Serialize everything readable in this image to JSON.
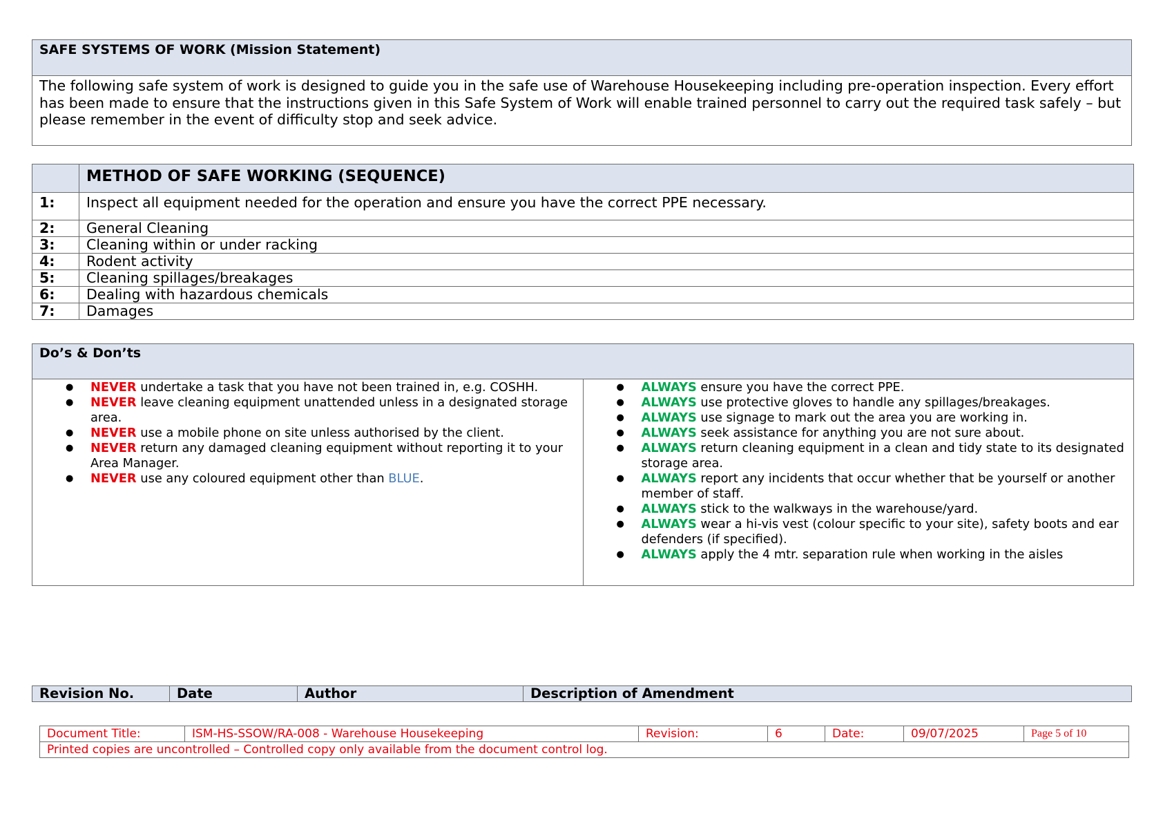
{
  "mission": {
    "title": "SAFE SYSTEMS OF WORK (Mission Statement)",
    "body": "The following safe system of work is designed to guide you in the safe use of Warehouse Housekeeping including pre-operation inspection. Every effort has been made to ensure that the instructions given in this Safe System of Work will enable trained personnel to carry out the required task safely – but please remember in the event of difficulty stop and seek advice."
  },
  "method": {
    "title": "METHOD OF SAFE WORKING (SEQUENCE)",
    "steps": [
      {
        "num": "1:",
        "text": "Inspect all equipment needed for the operation and ensure you have the correct PPE necessary."
      },
      {
        "num": "2:",
        "text": "General Cleaning"
      },
      {
        "num": "3:",
        "text": "Cleaning within or under racking"
      },
      {
        "num": "4:",
        "text": "Rodent activity"
      },
      {
        "num": "5:",
        "text": "Cleaning spillages/breakages"
      },
      {
        "num": "6:",
        "text": "Dealing with hazardous chemicals"
      },
      {
        "num": "7:",
        "text": "Damages"
      }
    ]
  },
  "dos": {
    "title": "Do’s & Don’ts",
    "never_word": "NEVER",
    "always_word": "ALWAYS",
    "never": [
      "undertake a task that you have not been trained in, e.g. COSHH.",
      "leave cleaning equipment unattended unless in a designated storage area.",
      "use a mobile phone on site unless authorised by the client.",
      "return any damaged cleaning equipment without reporting it to your Area Manager.",
      "use any coloured equipment other than"
    ],
    "never_last_blue": "BLUE",
    "never_last_end": ".",
    "always": [
      "ensure you have the correct PPE.",
      "use protective gloves to handle any spillages/breakages.",
      "use signage to mark out the area you are working in.",
      "seek assistance for anything you are not sure about.",
      "return cleaning equipment in a clean and tidy state to its designated storage area.",
      "report any incidents that occur whether that be yourself or another member of staff.",
      "stick to the walkways in the warehouse/yard.",
      "wear a hi-vis vest (colour specific to your site), safety boots and ear defenders (if specified).",
      "apply the 4 mtr. separation rule when working in the aisles"
    ],
    "colors": {
      "never": "#e8000b",
      "always": "#00a650",
      "blue": "#4a7ebb"
    }
  },
  "revision": {
    "headers": [
      "Revision No.",
      "Date",
      "Author",
      "Description of Amendment"
    ]
  },
  "footer": {
    "doc_title_label": "Document Title:",
    "doc_title": "ISM-HS-SSOW/RA-008 - Warehouse Housekeeping",
    "revision_label": "Revision:",
    "revision": "6",
    "date_label": "Date:",
    "date": "09/07/2025",
    "page": "Page 5 of 10",
    "notice": "Printed copies are uncontrolled – Controlled copy only available from the document control log."
  }
}
